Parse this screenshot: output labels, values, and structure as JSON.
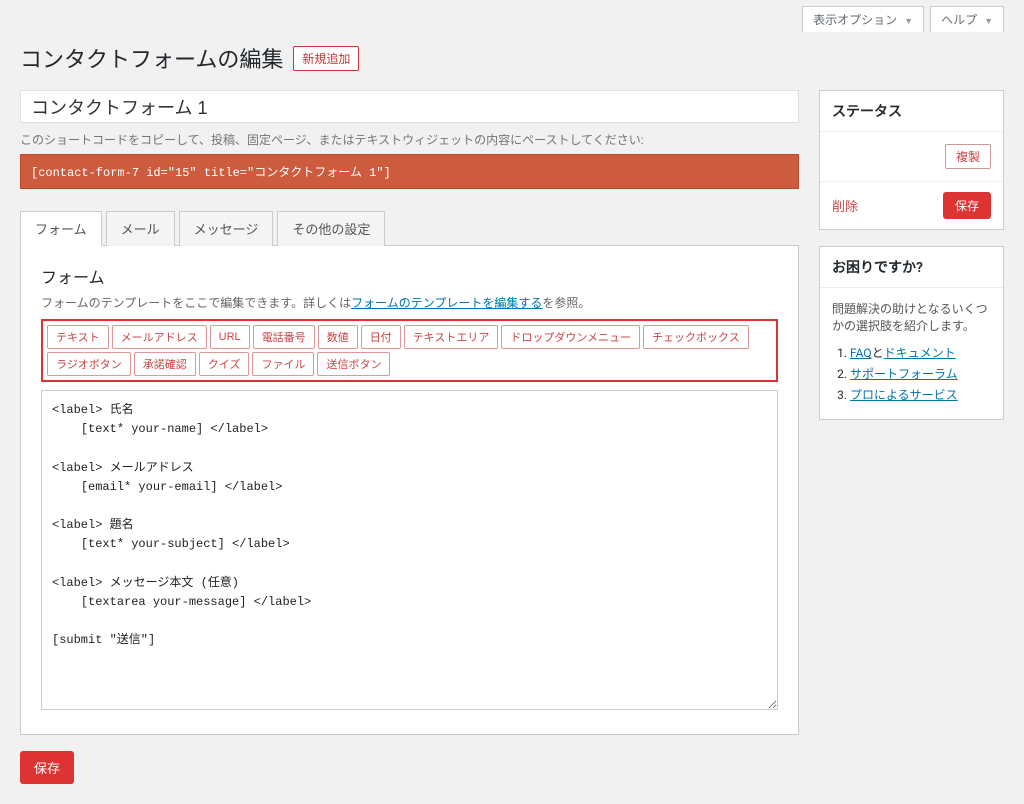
{
  "top": {
    "screen_options": "表示オプション",
    "help": "ヘルプ"
  },
  "heading": "コンタクトフォームの編集",
  "add_new": "新規追加",
  "title_value": "コンタクトフォーム 1",
  "shortcode_label": "このショートコードをコピーして、投稿、固定ページ、またはテキストウィジェットの内容にペーストしてください:",
  "shortcode": "[contact-form-7 id=\"15\" title=\"コンタクトフォーム 1\"]",
  "tabs": {
    "form": "フォーム",
    "mail": "メール",
    "message": "メッセージ",
    "other": "その他の設定"
  },
  "panel": {
    "title": "フォーム",
    "desc_prefix": "フォームのテンプレートをここで編集できます。詳しくは",
    "desc_link": "フォームのテンプレートを編集する",
    "desc_suffix": "を参照。"
  },
  "tags": [
    "テキスト",
    "メールアドレス",
    "URL",
    "電話番号",
    "数値",
    "日付",
    "テキストエリア",
    "ドロップダウンメニュー",
    "チェックボックス",
    "ラジオボタン",
    "承諾確認",
    "クイズ",
    "ファイル",
    "送信ボタン"
  ],
  "form_content": "<label> 氏名\n    [text* your-name] </label>\n\n<label> メールアドレス\n    [email* your-email] </label>\n\n<label> 題名\n    [text* your-subject] </label>\n\n<label> メッセージ本文 (任意)\n    [textarea your-message] </label>\n\n[submit \"送信\"]",
  "save": "保存",
  "status": {
    "title": "ステータス",
    "duplicate": "複製",
    "delete": "削除",
    "save": "保存"
  },
  "help_box": {
    "title": "お困りですか?",
    "desc": "問題解決の助けとなるいくつかの選択肢を紹介します。",
    "items": [
      {
        "prefix": "FAQ",
        "mid": "と",
        "suffix": "ドキュメント"
      },
      {
        "prefix": "サポートフォーラム",
        "mid": "",
        "suffix": ""
      },
      {
        "prefix": "プロによるサービス",
        "mid": "",
        "suffix": ""
      }
    ]
  }
}
